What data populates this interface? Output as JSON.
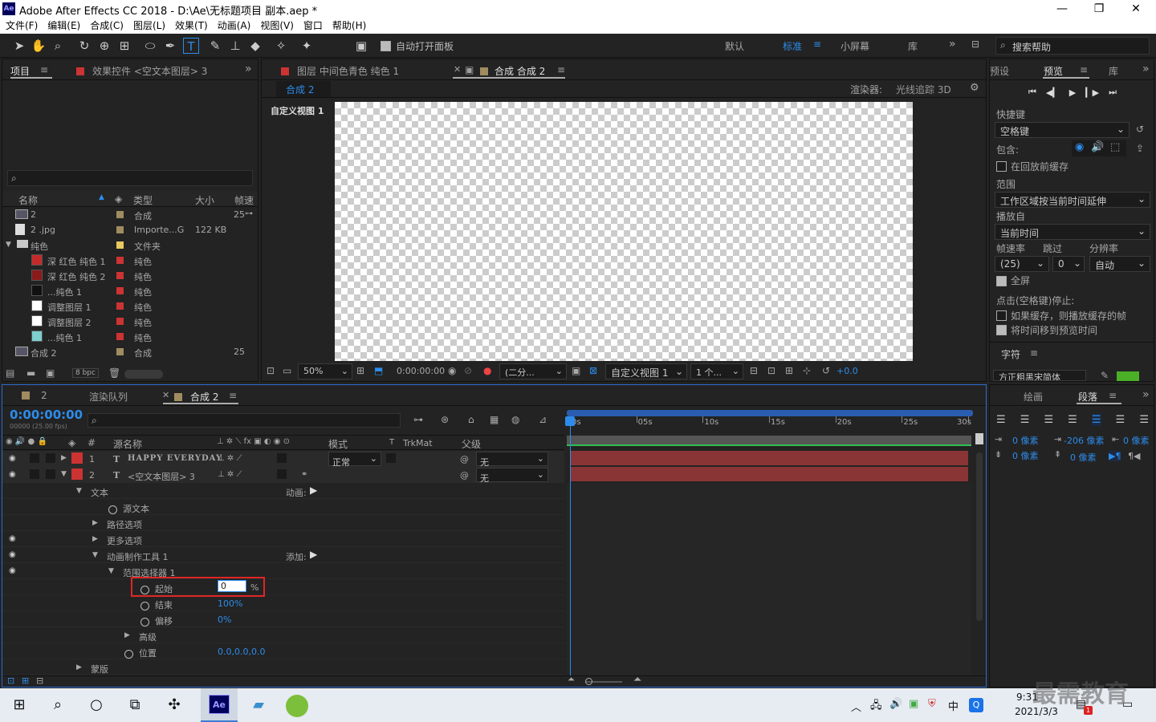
{
  "window": {
    "title": "Adobe After Effects CC 2018 - D:\\Ae\\无标题项目 副本.aep *",
    "app_icon": "Ae",
    "minimize": "—",
    "restore": "❐",
    "close": "✕"
  },
  "menu": [
    "文件(F)",
    "编辑(E)",
    "合成(C)",
    "图层(L)",
    "效果(T)",
    "动画(A)",
    "视图(V)",
    "窗口",
    "帮助(H)"
  ],
  "toolbar": {
    "auto_open_label": "自动打开面板",
    "workspaces": [
      "默认",
      "标准",
      "小屏幕",
      "库"
    ],
    "active_workspace": "标准",
    "search_placeholder": "搜索帮助",
    "more": "»"
  },
  "project_panel": {
    "tabs": [
      "项目",
      "效果控件 <空文本图层> 3"
    ],
    "search_icon": "⌕",
    "columns": [
      "名称",
      "类型",
      "大小",
      "帧速"
    ],
    "items": [
      {
        "name": "2",
        "type": "合成",
        "size": "",
        "fps": "25",
        "swatch": "#a08c60",
        "icon": "comp"
      },
      {
        "name": "2 .jpg",
        "type": "Importe...G",
        "size": "122 KB",
        "fps": "",
        "swatch": "#a08c60",
        "icon": "file"
      },
      {
        "name": "纯色",
        "type": "文件夹",
        "size": "",
        "fps": "",
        "swatch": "#e8c860",
        "icon": "folder"
      },
      {
        "name": "深 红色 纯色 1",
        "type": "纯色",
        "size": "",
        "fps": "",
        "swatch": "#c33",
        "color": "#c42a2a"
      },
      {
        "name": "深 红色 纯色 2",
        "type": "纯色",
        "size": "",
        "fps": "",
        "swatch": "#c33",
        "color": "#8b1a1a"
      },
      {
        "name": "...纯色 1",
        "type": "纯色",
        "size": "",
        "fps": "",
        "swatch": "#c33",
        "color": "#111111"
      },
      {
        "name": "调整图层 1",
        "type": "纯色",
        "size": "",
        "fps": "",
        "swatch": "#c33",
        "color": "#ffffff"
      },
      {
        "name": "调整图层 2",
        "type": "纯色",
        "size": "",
        "fps": "",
        "swatch": "#c33",
        "color": "#ffffff"
      },
      {
        "name": "...纯色 1",
        "type": "纯色",
        "size": "",
        "fps": "",
        "swatch": "#c33",
        "color": "#7ecfcf"
      },
      {
        "name": "合成 2",
        "type": "合成",
        "size": "",
        "fps": "25",
        "swatch": "#a08c60",
        "icon": "comp"
      }
    ],
    "bpc": "8 bpc"
  },
  "comp_panel": {
    "tabs": [
      "图层 中间色青色 纯色 1",
      "合成 合成 2"
    ],
    "subtab": "合成 2",
    "renderer_label": "渲染器:",
    "renderer": "光线追踪 3D",
    "view_label": "自定义视图 1",
    "zoom": "50%",
    "time": "0:00:00:00",
    "resolution": "(二分...",
    "view": "自定义视图 1",
    "views": "1 个...",
    "exposure": "+0.0"
  },
  "preview_panel": {
    "tabs": [
      "预设",
      "预览",
      "库"
    ],
    "shortcut_label": "快捷键",
    "shortcut": "空格键",
    "include_label": "包含:",
    "cache_before": "在回放前缓存",
    "range_label": "范围",
    "range": "工作区域按当前时间延伸",
    "play_from_label": "播放自",
    "play_from": "当前时间",
    "fps_label": "帧速率",
    "skip_label": "跳过",
    "res_label": "分辨率",
    "fps": "(25)",
    "skip": "0",
    "res": "自动",
    "fullscreen": "全屏",
    "stop_label": "点击(空格键)停止:",
    "if_cached": "如果缓存，则播放缓存的帧",
    "move_time": "将时间移到预览时间",
    "char_tab": "字符",
    "font": "方正粗黑宋简体"
  },
  "timeline": {
    "tabs": [
      "2",
      "渲染队列",
      "合成 2"
    ],
    "time": "0:00:00:00",
    "fps_sub": "00000 (25.00 fps)",
    "search_placeholder": "",
    "columns": {
      "num": "#",
      "src": "源名称",
      "mode": "模式",
      "t": "T",
      "trkmat": "TrkMat",
      "parent": "父级"
    },
    "layers": [
      {
        "num": "1",
        "name": "HAPPY EVERYDAY",
        "mode": "正常",
        "parent": "无"
      },
      {
        "num": "2",
        "name": "<空文本图层> 3",
        "mode": "",
        "parent": "无"
      }
    ],
    "props": [
      {
        "label": "文本",
        "extra": "动画:",
        "indent": 0,
        "tri": "▼"
      },
      {
        "label": "源文本",
        "indent": 1,
        "stopwatch": true
      },
      {
        "label": "路径选项",
        "indent": 1,
        "tri": "▶"
      },
      {
        "label": "更多选项",
        "indent": 1,
        "tri": "▶"
      },
      {
        "label": "动画制作工具 1",
        "extra": "添加:",
        "indent": 1,
        "tri": "▼"
      },
      {
        "label": "范围选择器 1",
        "indent": 2,
        "tri": "▼"
      },
      {
        "label": "起始",
        "value": "0",
        "unit": "%",
        "indent": 3,
        "stopwatch": true,
        "highlight": true
      },
      {
        "label": "结束",
        "value": "100%",
        "indent": 3,
        "stopwatch": true
      },
      {
        "label": "偏移",
        "value": "0%",
        "indent": 3,
        "stopwatch": true
      },
      {
        "label": "高级",
        "indent": 3,
        "tri": "▶"
      },
      {
        "label": "位置",
        "value": "0.0,0.0,0.0",
        "indent": 2,
        "stopwatch": true
      },
      {
        "label": "蒙版",
        "indent": 0,
        "tri": "▶"
      }
    ],
    "ruler": [
      "0s",
      "05s",
      "10s",
      "15s",
      "20s",
      "25s",
      "30s"
    ]
  },
  "paragraph_panel": {
    "tabs": [
      "绘画",
      "段落"
    ],
    "indent_left": "0 像素",
    "indent_first": "-206 像素",
    "indent_right": "0 像素",
    "space_before": "0 像素",
    "space_after": "0 像素"
  },
  "taskbar": {
    "time": "9:31",
    "date": "2021/3/3",
    "lang": "中",
    "notif_count": "1",
    "watermark": "最需教育"
  }
}
